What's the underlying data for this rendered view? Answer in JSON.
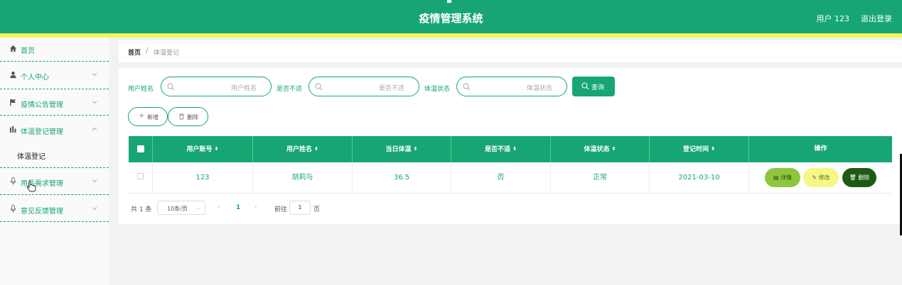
{
  "header": {
    "title": "疫情管理系统",
    "user": "用户 123",
    "logout": "退出登录"
  },
  "sidebar": {
    "items": [
      {
        "label": "首页",
        "icon": "home-icon"
      },
      {
        "label": "个人中心",
        "icon": "user-icon"
      },
      {
        "label": "疫情公告管理",
        "icon": "flag-icon"
      },
      {
        "label": "体温登记管理",
        "icon": "chart-icon"
      },
      {
        "label": "用品需求管理",
        "icon": "mic-icon"
      },
      {
        "label": "意见反馈管理",
        "icon": "mic-icon"
      }
    ],
    "submenu": {
      "label": "体温登记"
    }
  },
  "breadcrumb": {
    "home": "首页",
    "separator": "/",
    "current": "体温登记"
  },
  "filters": {
    "name_label": "用户姓名",
    "name_placeholder": "用户姓名",
    "unwell_label": "是否不适",
    "unwell_placeholder": "是否不适",
    "status_label": "体温状态",
    "status_placeholder": "体温状态",
    "query_button": "查询"
  },
  "actions": {
    "add": "新增",
    "delete": "删除"
  },
  "table": {
    "headers": [
      "用户账号",
      "用户姓名",
      "当日体温",
      "是否不适",
      "体温状态",
      "登记时间",
      "操作"
    ],
    "rows": [
      {
        "account": "123",
        "name": "胡莉与",
        "temp": "36.5",
        "unwell": "否",
        "status": "正常",
        "date": "2021-03-10"
      }
    ],
    "row_actions": {
      "detail": "详情",
      "edit": "修改",
      "delete": "删除"
    }
  },
  "pagination": {
    "total": "共 1 条",
    "page_size": "10条/页",
    "current_page": "1",
    "goto": "前往",
    "goto_value": "1",
    "page_unit": "页"
  },
  "colors": {
    "primary": "#17a673",
    "stripe": "#f4f45a",
    "detail_btn": "#8ec63f",
    "edit_btn": "#f6f784",
    "delete_btn": "#1f5a15"
  }
}
